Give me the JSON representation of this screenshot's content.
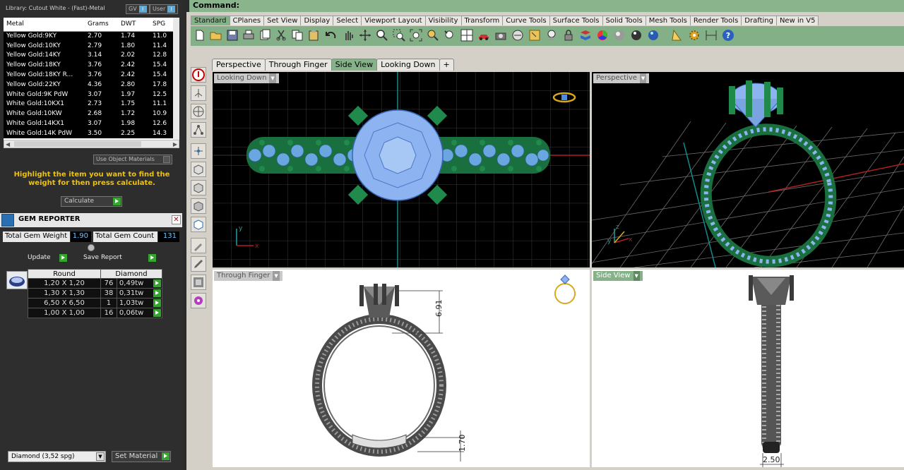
{
  "library": {
    "title": "Library: Cutout White - (Fast)-Metal",
    "gv_label": "GV",
    "user_label": "User"
  },
  "metal_table": {
    "headers": [
      "Metal",
      "Grams",
      "DWT",
      "SPG"
    ],
    "rows": [
      [
        "Yellow Gold:9KY",
        "2.70",
        "1.74",
        "11.0"
      ],
      [
        "Yellow Gold:10KY",
        "2.79",
        "1.80",
        "11.4"
      ],
      [
        "Yellow Gold:14KY",
        "3.14",
        "2.02",
        "12.8"
      ],
      [
        "Yellow Gold:18KY",
        "3.76",
        "2.42",
        "15.4"
      ],
      [
        "Yellow Gold:18KY R...",
        "3.76",
        "2.42",
        "15.4"
      ],
      [
        "Yellow Gold:22KY",
        "4.36",
        "2.80",
        "17.8"
      ],
      [
        "White Gold:9K PdW",
        "3.07",
        "1.97",
        "12.5"
      ],
      [
        "White Gold:10KX1",
        "2.73",
        "1.75",
        "11.1"
      ],
      [
        "White Gold:10KW",
        "2.68",
        "1.72",
        "10.9"
      ],
      [
        "White Gold:14KX1",
        "3.07",
        "1.98",
        "12.6"
      ],
      [
        "White Gold:14K PdW",
        "3.50",
        "2.25",
        "14.3"
      ]
    ]
  },
  "use_object_materials": "Use Object Materials",
  "highlight_text": "Highlight the item you want to find the weight for then press calculate.",
  "calculate_label": "Calculate",
  "gem_reporter": {
    "title": "GEM REPORTER",
    "total_weight_label": "Total Gem Weight",
    "total_weight_value": "1.90",
    "total_count_label": "Total Gem Count",
    "total_count_value": "131",
    "update_label": "Update",
    "save_report_label": "Save Report",
    "headers": [
      "Round",
      "Diamond"
    ],
    "rows": [
      [
        "1,20 X 1,20",
        "76",
        "0,49tw"
      ],
      [
        "1,30 X 1,30",
        "38",
        "0,31tw"
      ],
      [
        "6,50 X 6,50",
        "1",
        "1,03tw"
      ],
      [
        "1,00 X 1,00",
        "16",
        "0,06tw"
      ]
    ],
    "material_select": "Diamond    (3,52 spg)",
    "set_material_label": "Set Material"
  },
  "command_label": "Command:",
  "toolbar_tabs": [
    "Standard",
    "CPlanes",
    "Set View",
    "Display",
    "Select",
    "Viewport Layout",
    "Visibility",
    "Transform",
    "Curve Tools",
    "Surface Tools",
    "Solid Tools",
    "Mesh Tools",
    "Render Tools",
    "Drafting",
    "New in V5"
  ],
  "viewport_tabs": [
    "Perspective",
    "Through Finger",
    "Side View",
    "Looking Down"
  ],
  "viewports": {
    "top_left": "Looking Down",
    "top_right": "Perspective",
    "bottom_left": "Through Finger",
    "bottom_right": "Side View"
  },
  "dims": {
    "height": "6.91",
    "band": "1.70",
    "width": "2.50"
  },
  "axis": {
    "x": "x",
    "y": "y",
    "z": "z"
  },
  "colors": {
    "accent_green": "#86b289",
    "gem_blue": "#8db4f0",
    "prong_green": "#1f8a4c"
  }
}
